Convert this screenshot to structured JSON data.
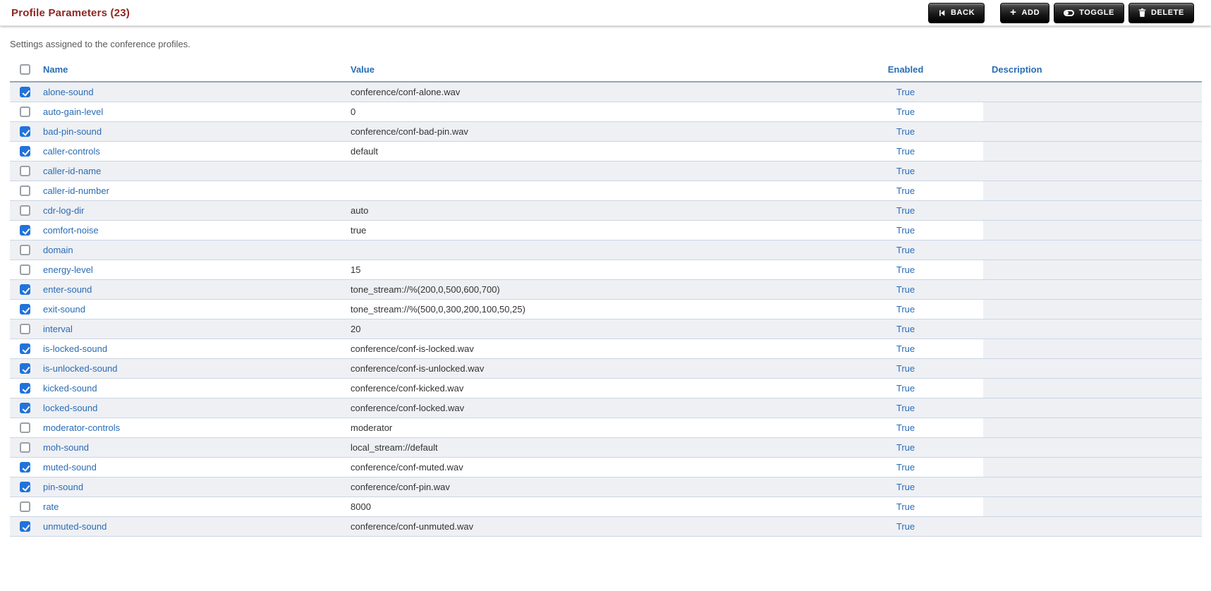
{
  "header": {
    "title": "Profile Parameters (23)",
    "buttons": [
      {
        "id": "back",
        "label": "BACK",
        "icon": "skip-back-icon"
      },
      {
        "id": "add",
        "label": "ADD",
        "icon": "plus-icon"
      },
      {
        "id": "toggle",
        "label": "TOGGLE",
        "icon": "toggle-icon"
      },
      {
        "id": "delete",
        "label": "DELETE",
        "icon": "trash-icon"
      }
    ]
  },
  "subtitle": "Settings assigned to the conference profiles.",
  "table": {
    "columns": {
      "name": "Name",
      "value": "Value",
      "enabled": "Enabled",
      "description": "Description"
    },
    "rows": [
      {
        "checked": true,
        "name": "alone-sound",
        "value": "conference/conf-alone.wav",
        "enabled": "True",
        "description": ""
      },
      {
        "checked": false,
        "name": "auto-gain-level",
        "value": "0",
        "enabled": "True",
        "description": ""
      },
      {
        "checked": true,
        "name": "bad-pin-sound",
        "value": "conference/conf-bad-pin.wav",
        "enabled": "True",
        "description": ""
      },
      {
        "checked": true,
        "name": "caller-controls",
        "value": "default",
        "enabled": "True",
        "description": ""
      },
      {
        "checked": false,
        "name": "caller-id-name",
        "value": "",
        "enabled": "True",
        "description": ""
      },
      {
        "checked": false,
        "name": "caller-id-number",
        "value": "",
        "enabled": "True",
        "description": ""
      },
      {
        "checked": false,
        "name": "cdr-log-dir",
        "value": "auto",
        "enabled": "True",
        "description": ""
      },
      {
        "checked": true,
        "name": "comfort-noise",
        "value": "true",
        "enabled": "True",
        "description": ""
      },
      {
        "checked": false,
        "name": "domain",
        "value": "",
        "enabled": "True",
        "description": ""
      },
      {
        "checked": false,
        "name": "energy-level",
        "value": "15",
        "enabled": "True",
        "description": ""
      },
      {
        "checked": true,
        "name": "enter-sound",
        "value": "tone_stream://%(200,0,500,600,700)",
        "enabled": "True",
        "description": ""
      },
      {
        "checked": true,
        "name": "exit-sound",
        "value": "tone_stream://%(500,0,300,200,100,50,25)",
        "enabled": "True",
        "description": ""
      },
      {
        "checked": false,
        "name": "interval",
        "value": "20",
        "enabled": "True",
        "description": ""
      },
      {
        "checked": true,
        "name": "is-locked-sound",
        "value": "conference/conf-is-locked.wav",
        "enabled": "True",
        "description": ""
      },
      {
        "checked": true,
        "name": "is-unlocked-sound",
        "value": "conference/conf-is-unlocked.wav",
        "enabled": "True",
        "description": ""
      },
      {
        "checked": true,
        "name": "kicked-sound",
        "value": "conference/conf-kicked.wav",
        "enabled": "True",
        "description": ""
      },
      {
        "checked": true,
        "name": "locked-sound",
        "value": "conference/conf-locked.wav",
        "enabled": "True",
        "description": ""
      },
      {
        "checked": false,
        "name": "moderator-controls",
        "value": "moderator",
        "enabled": "True",
        "description": ""
      },
      {
        "checked": false,
        "name": "moh-sound",
        "value": "local_stream://default",
        "enabled": "True",
        "description": ""
      },
      {
        "checked": true,
        "name": "muted-sound",
        "value": "conference/conf-muted.wav",
        "enabled": "True",
        "description": ""
      },
      {
        "checked": true,
        "name": "pin-sound",
        "value": "conference/conf-pin.wav",
        "enabled": "True",
        "description": ""
      },
      {
        "checked": false,
        "name": "rate",
        "value": "8000",
        "enabled": "True",
        "description": ""
      },
      {
        "checked": true,
        "name": "unmuted-sound",
        "value": "conference/conf-unmuted.wav",
        "enabled": "True",
        "description": ""
      }
    ]
  },
  "colors": {
    "title_red": "#8e2722",
    "link_blue": "#2a6cb5",
    "checkbox_blue": "#2173da",
    "stripe_gray": "#eef0f4",
    "row_border": "#ccd6e4",
    "header_border": "#98a5b8"
  }
}
